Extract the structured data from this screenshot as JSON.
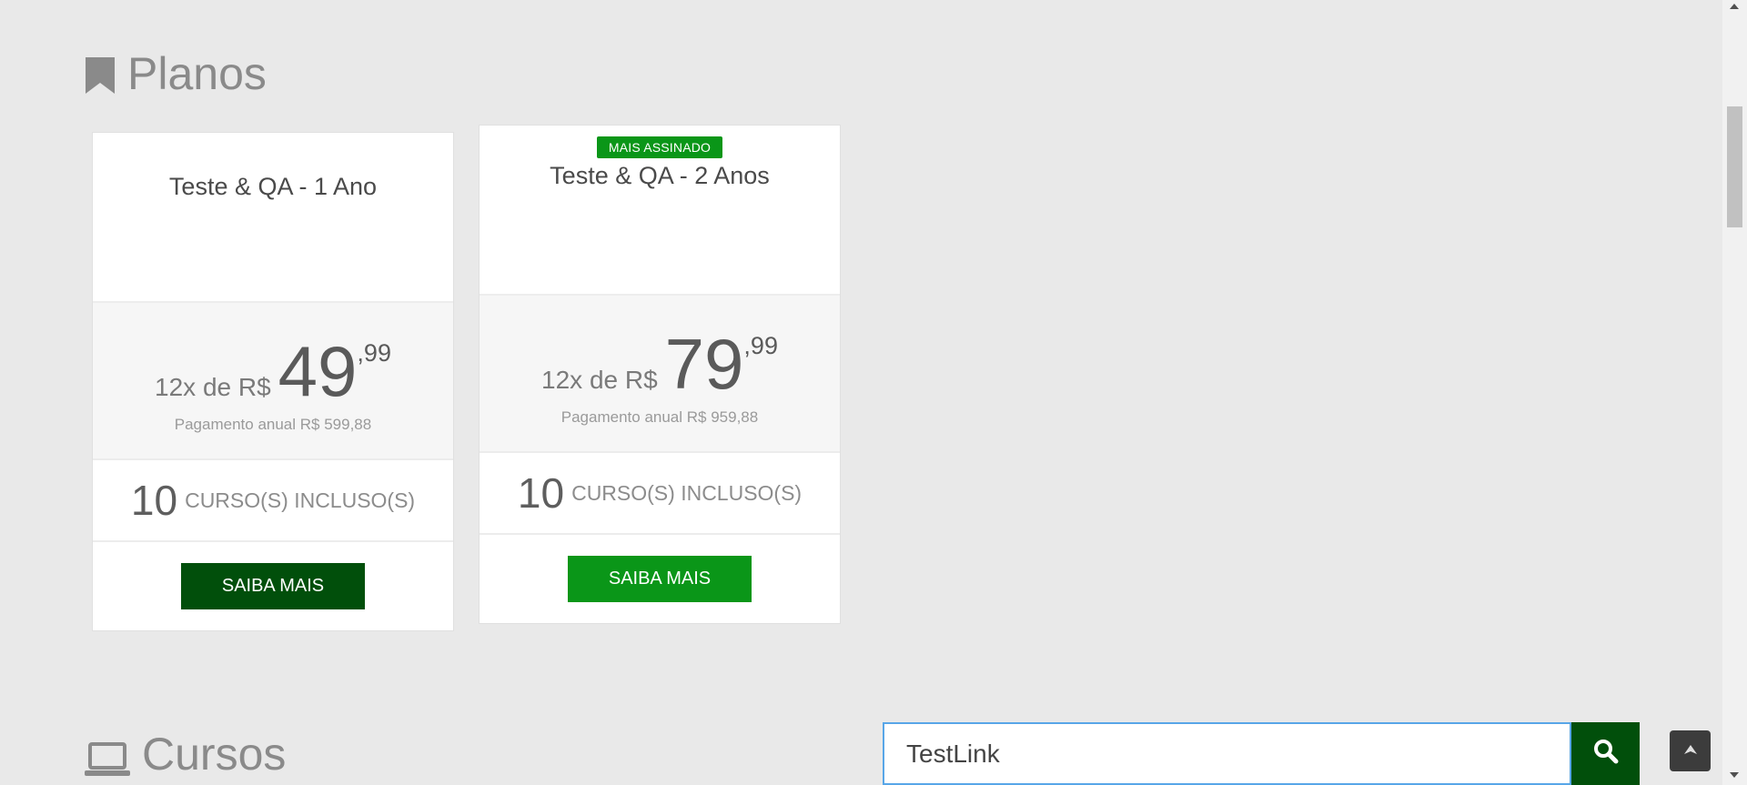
{
  "sections": {
    "planos_title": "Planos",
    "cursos_title": "Cursos"
  },
  "plans": [
    {
      "badge": "",
      "name": "Teste & QA - 1 Ano",
      "price_prefix": "12x de R$",
      "price_integer": "49",
      "price_cents": ",99",
      "annual_payment": "Pagamento anual R$ 599,88",
      "courses_count": "10",
      "courses_label": "CURSO(S) INCLUSO(S)",
      "cta_label": "SAIBA MAIS"
    },
    {
      "badge": "MAIS ASSINADO",
      "name": "Teste & QA - 2 Anos",
      "price_prefix": "12x de R$",
      "price_integer": "79",
      "price_cents": ",99",
      "annual_payment": "Pagamento anual R$ 959,88",
      "courses_count": "10",
      "courses_label": "CURSO(S) INCLUSO(S)",
      "cta_label": "SAIBA MAIS"
    }
  ],
  "search": {
    "value": "TestLink",
    "icon": "search-icon"
  },
  "colors": {
    "primary_green": "#0a9618",
    "dark_green": "#014f0b",
    "focus_blue": "#58a6e8"
  }
}
